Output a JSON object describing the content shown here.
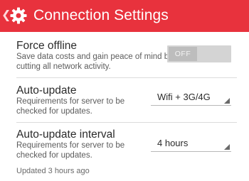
{
  "header": {
    "back_icon": "chevron-left-icon",
    "app_icon": "gear-icon",
    "title": "Connection Settings",
    "accent_color": "#e8323d"
  },
  "force_offline": {
    "title": "Force offline",
    "description_line1": "Save data costs and gain peace of mind by",
    "description_line2": "cutting all network activity.",
    "toggle_label": "OFF",
    "enabled": false
  },
  "auto_update": {
    "title": "Auto-update",
    "description_line1": "Requirements for server to be",
    "description_line2": "checked for updates.",
    "selected": "Wifi + 3G/4G"
  },
  "auto_update_interval": {
    "title": "Auto-update interval",
    "description_line1": "Requirements for server to be",
    "description_line2": "checked for updates.",
    "selected": "4 hours"
  },
  "status": {
    "updated_text": "Updated 3 hours ago"
  }
}
